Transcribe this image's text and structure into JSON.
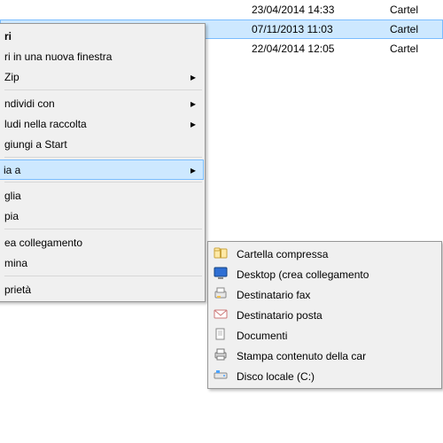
{
  "file_rows": [
    {
      "date": "23/04/2014 14:33",
      "type": "Cartel"
    },
    {
      "date": "07/11/2013 11:03",
      "type": "Cartel",
      "selected": true
    },
    {
      "date": "22/04/2014 12:05",
      "type": "Cartel"
    }
  ],
  "main_menu": {
    "items": [
      {
        "label": "ri",
        "bold": true
      },
      {
        "label": "ri in una nuova finestra"
      },
      {
        "label": "Zip",
        "submenu": true
      },
      {
        "sep": true
      },
      {
        "label": "ndividi con",
        "submenu": true
      },
      {
        "label": "ludi nella raccolta",
        "submenu": true
      },
      {
        "label": "giungi a Start"
      },
      {
        "sep": true
      },
      {
        "label": "ia a",
        "submenu": true,
        "highlighted": true
      },
      {
        "sep": true
      },
      {
        "label": "glia"
      },
      {
        "label": "pia"
      },
      {
        "sep": true
      },
      {
        "label": "ea collegamento"
      },
      {
        "label": "mina"
      },
      {
        "sep": true
      },
      {
        "label": "prietà"
      }
    ]
  },
  "sub_menu": {
    "items": [
      {
        "icon": "zip-folder-icon",
        "label": "Cartella compressa"
      },
      {
        "icon": "desktop-icon",
        "label": "Desktop (crea collegamento"
      },
      {
        "icon": "fax-icon",
        "label": "Destinatario fax"
      },
      {
        "icon": "mail-icon",
        "label": "Destinatario posta"
      },
      {
        "icon": "documents-icon",
        "label": "Documenti"
      },
      {
        "icon": "printer-icon",
        "label": "Stampa contenuto della car"
      },
      {
        "icon": "drive-icon",
        "label": "Disco locale (C:)"
      }
    ]
  }
}
